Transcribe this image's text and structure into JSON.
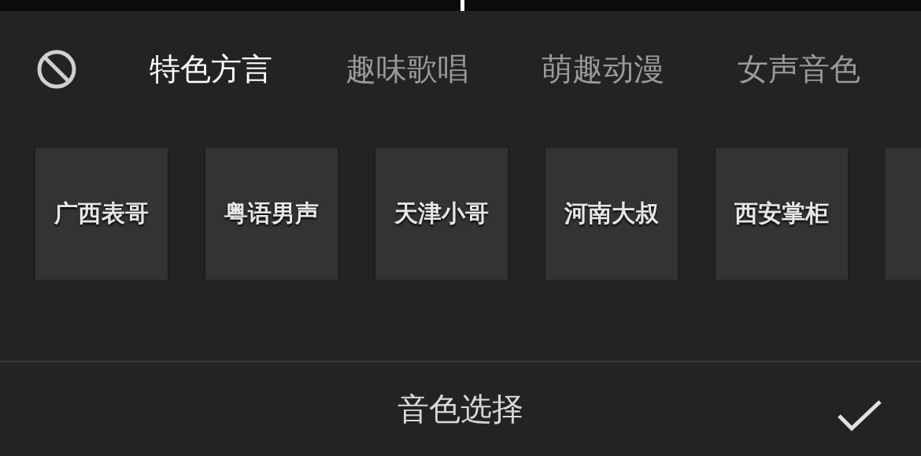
{
  "tabs": [
    {
      "label": "特色方言",
      "selected": true
    },
    {
      "label": "趣味歌唱",
      "selected": false
    },
    {
      "label": "萌趣动漫",
      "selected": false
    },
    {
      "label": "女声音色",
      "selected": false
    }
  ],
  "voices": [
    {
      "label": "广西表哥"
    },
    {
      "label": "粤语男声"
    },
    {
      "label": "天津小哥"
    },
    {
      "label": "河南大叔"
    },
    {
      "label": "西安掌柜"
    }
  ],
  "more_voices_cut": true,
  "footer": {
    "title": "音色选择"
  }
}
